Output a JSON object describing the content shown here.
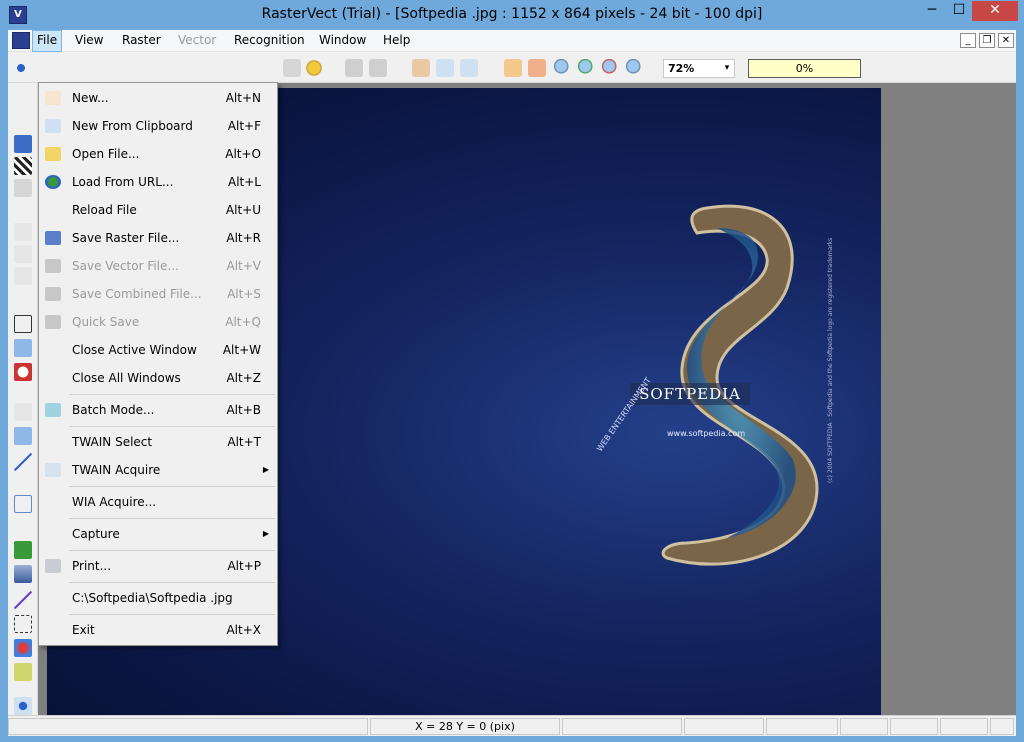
{
  "titlebar": {
    "app_icon": "V",
    "title": "RasterVect (Trial) - [Softpedia .jpg : 1152 x 864 pixels - 24 bit - 100 dpi]",
    "minimize": "─",
    "maximize": "☐",
    "close": "✕"
  },
  "menubar": {
    "items": [
      {
        "label": "File",
        "state": "active"
      },
      {
        "label": "View",
        "state": "normal"
      },
      {
        "label": "Raster",
        "state": "normal"
      },
      {
        "label": "Vector",
        "state": "disabled"
      },
      {
        "label": "Recognition",
        "state": "normal"
      },
      {
        "label": "Window",
        "state": "normal"
      },
      {
        "label": "Help",
        "state": "normal"
      }
    ],
    "mdi": {
      "minimize": "_",
      "restore": "❐",
      "close": "✕"
    }
  },
  "toolbar": {
    "zoom_value": "72%",
    "zoom_arrow": "▾",
    "progress_value": "0%",
    "progress_fraction": 0
  },
  "file_menu": {
    "items": [
      {
        "label": "New...",
        "shortcut": "Alt+N",
        "icon": "new-document-icon",
        "enabled": true
      },
      {
        "label": "New From Clipboard",
        "shortcut": "Alt+F",
        "icon": "clipboard-icon",
        "enabled": true
      },
      {
        "label": "Open File...",
        "shortcut": "Alt+O",
        "icon": "folder-icon",
        "enabled": true
      },
      {
        "label": "Load From URL...",
        "shortcut": "Alt+L",
        "icon": "globe-icon",
        "enabled": true
      },
      {
        "label": "Reload File",
        "shortcut": "Alt+U",
        "icon": "",
        "enabled": true
      },
      {
        "label": "Save Raster File...",
        "shortcut": "Alt+R",
        "icon": "save-icon",
        "enabled": true
      },
      {
        "label": "Save Vector File...",
        "shortcut": "Alt+V",
        "icon": "save-icon",
        "enabled": false
      },
      {
        "label": "Save Combined File...",
        "shortcut": "Alt+S",
        "icon": "save-icon",
        "enabled": false
      },
      {
        "label": "Quick Save",
        "shortcut": "Alt+Q",
        "icon": "save-icon",
        "enabled": false
      },
      {
        "label": "Close Active Window",
        "shortcut": "Alt+W",
        "icon": "",
        "enabled": true
      },
      {
        "label": "Close All Windows",
        "shortcut": "Alt+Z",
        "icon": "",
        "enabled": true
      },
      {
        "label": "Batch Mode...",
        "shortcut": "Alt+B",
        "icon": "batch-icon",
        "enabled": true
      },
      {
        "label": "TWAIN Select",
        "shortcut": "Alt+T",
        "icon": "",
        "enabled": true
      },
      {
        "label": "TWAIN Acquire",
        "shortcut": "",
        "icon": "scanner-icon",
        "enabled": true,
        "submenu": true
      },
      {
        "label": "WIA Acquire...",
        "shortcut": "",
        "icon": "",
        "enabled": true
      },
      {
        "label": "Capture",
        "shortcut": "",
        "icon": "",
        "enabled": true,
        "submenu": true
      },
      {
        "label": "Print...",
        "shortcut": "Alt+P",
        "icon": "printer-icon",
        "enabled": true
      },
      {
        "label": "C:\\Softpedia\\Softpedia .jpg",
        "shortcut": "",
        "icon": "",
        "enabled": true
      },
      {
        "label": "Exit",
        "shortcut": "Alt+X",
        "icon": "",
        "enabled": true
      }
    ],
    "submenu_arrow": "▶"
  },
  "canvas": {
    "brand": "SOFTPEDIA",
    "url": "www.softpedia.com",
    "tagline": "WEB ENTERTAINMENT",
    "vertical_text": "(c) 2004 SOFTPEDIA · Softpedia and the Softpedia logo are registered trademarks",
    "watermark": "softpedia.com"
  },
  "statusbar": {
    "coords": "X = 28   Y = 0 (pix)"
  },
  "colors": {
    "titlebar": "#6fa9dc",
    "close_button": "#c74646",
    "progress_fill": "#ffffc8",
    "canvas_deep": "#0b1644"
  }
}
